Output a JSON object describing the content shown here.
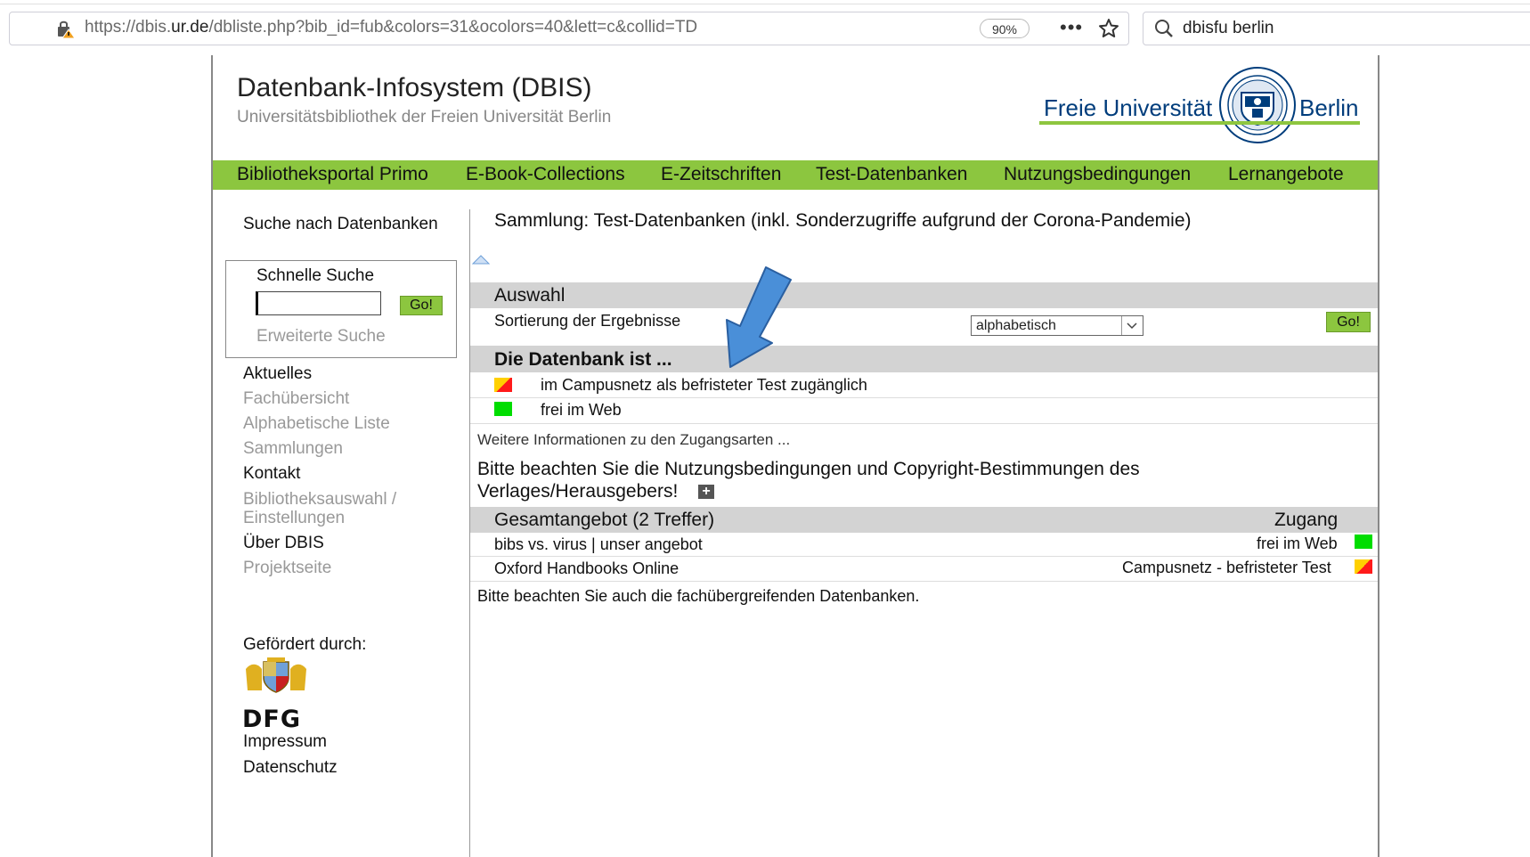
{
  "browser": {
    "url_prefix": "https://dbis.",
    "url_domain": "ur.de",
    "url_rest": "/dbliste.php?bib_id=fub&colors=31&ocolors=40&lett=c&collid=TD",
    "zoom": "90%",
    "search_text": "dbisfu berlin"
  },
  "header": {
    "title": "Datenbank-Infosystem (DBIS)",
    "subtitle": "Universitätsbibliothek der Freien Universität Berlin",
    "logo_left": "Freie Universität",
    "logo_right": "Berlin"
  },
  "nav": [
    "Bibliotheksportal Primo",
    "E-Book-Collections",
    "E-Zeitschriften",
    "Test-Datenbanken",
    "Nutzungsbedingungen",
    "Lernangebote"
  ],
  "sidebar": {
    "search_heading": "Suche nach Datenbanken",
    "quick_search_label": "Schnelle Suche",
    "quick_search_value": "",
    "go_label": "Go!",
    "advanced_search": "Erweiterte Suche",
    "items": [
      "Aktuelles",
      "Fachübersicht",
      "Alphabetische Liste",
      "Sammlungen",
      "Kontakt",
      "Bibliotheksauswahl /",
      "Einstellungen",
      "Über DBIS",
      "Projektseite"
    ],
    "funded_by": "Gefördert durch:",
    "dfg": "DFG",
    "impressum": "Impressum",
    "datenschutz": "Datenschutz"
  },
  "main": {
    "collection_title": "Sammlung: Test-Datenbanken (inkl. Sonderzugriffe aufgrund der Corona-Pandemie)",
    "auswahl_heading": "Auswahl",
    "sort_label": "Sortierung der Ergebnisse",
    "sort_value": "alphabetisch",
    "go_label": "Go!",
    "db_is_heading": "Die Datenbank ist ...",
    "legend": [
      {
        "text": "im Campusnetz als befristeter Test zugänglich"
      },
      {
        "text": "frei im Web"
      }
    ],
    "more_info": "Weitere Informationen zu den Zugangsarten ...",
    "notice_line1": "Bitte beachten Sie die Nutzungsbedingungen und Copyright-Bestimmungen des",
    "notice_line2": "Verlages/Herausgebers!",
    "results_heading": "Gesamtangebot (2 Treffer)",
    "access_heading": "Zugang",
    "results": [
      {
        "name": "bibs vs. virus | unser angebot",
        "access": "frei im Web"
      },
      {
        "name": "Oxford Handbooks Online",
        "access": "Campusnetz - befristeter Test"
      }
    ],
    "footer_note": "Bitte beachten Sie auch die fachübergreifenden Datenbanken."
  },
  "colors": {
    "nav_green": "#8cc63f",
    "section_gray": "#d3d3d3",
    "fu_blue": "#003d7c",
    "arrow_blue": "#4a8fd8"
  }
}
